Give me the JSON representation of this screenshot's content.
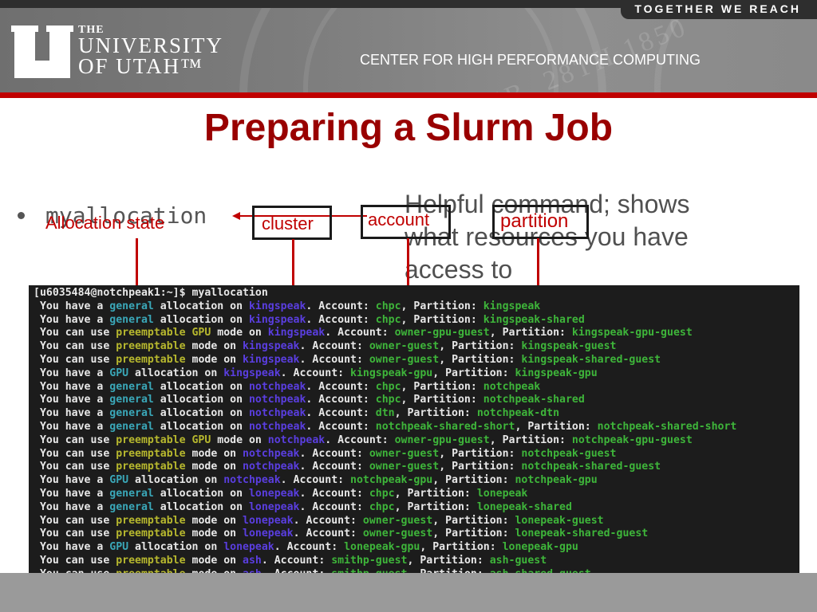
{
  "header": {
    "tagline": "TOGETHER WE REACH",
    "university_the": "THE",
    "university_line1": "UNIVERSITY",
    "university_line2": "OF UTAH™",
    "center_name": "CENTER FOR HIGH PERFORMANCE COMPUTING",
    "seal_text": "FEB. 28TH 1850",
    "colors": {
      "accent_red": "#c00000",
      "title_red": "#990000"
    }
  },
  "slide": {
    "title": "Preparing a Slurm Job",
    "bullet_command": "myallocation",
    "helpful_text": "Helpful command; shows what resources you have access to"
  },
  "annotations": {
    "allocation_state": "Allocation state",
    "cluster": "cluster",
    "account": "account",
    "partition": "partition"
  },
  "terminal": {
    "prompt": "[u6035484@notchpeak1:~]$ myallocation",
    "lines": [
      {
        "lead": " You have a ",
        "type": "general",
        "type_color": "cyan",
        "mid": " allocation on ",
        "cluster": "kingspeak",
        "account": "chpc",
        "partition": "kingspeak"
      },
      {
        "lead": " You have a ",
        "type": "general",
        "type_color": "cyan",
        "mid": " allocation on ",
        "cluster": "kingspeak",
        "account": "chpc",
        "partition": "kingspeak-shared"
      },
      {
        "lead": " You can use ",
        "type": "preemptable GPU",
        "type_color": "yellow",
        "mid": " mode on ",
        "cluster": "kingspeak",
        "account": "owner-gpu-guest",
        "partition": "kingspeak-gpu-guest"
      },
      {
        "lead": " You can use ",
        "type": "preemptable",
        "type_color": "yellow",
        "mid": " mode on ",
        "cluster": "kingspeak",
        "account": "owner-guest",
        "partition": "kingspeak-guest"
      },
      {
        "lead": " You can use ",
        "type": "preemptable",
        "type_color": "yellow",
        "mid": " mode on ",
        "cluster": "kingspeak",
        "account": "owner-guest",
        "partition": "kingspeak-shared-guest"
      },
      {
        "lead": " You have a ",
        "type": "GPU",
        "type_color": "cyan",
        "mid": " allocation on ",
        "cluster": "kingspeak",
        "account": "kingspeak-gpu",
        "partition": "kingspeak-gpu"
      },
      {
        "lead": " You have a ",
        "type": "general",
        "type_color": "cyan",
        "mid": " allocation on ",
        "cluster": "notchpeak",
        "account": "chpc",
        "partition": "notchpeak"
      },
      {
        "lead": " You have a ",
        "type": "general",
        "type_color": "cyan",
        "mid": " allocation on ",
        "cluster": "notchpeak",
        "account": "chpc",
        "partition": "notchpeak-shared"
      },
      {
        "lead": " You have a ",
        "type": "general",
        "type_color": "cyan",
        "mid": " allocation on ",
        "cluster": "notchpeak",
        "account": "dtn",
        "partition": "notchpeak-dtn"
      },
      {
        "lead": " You have a ",
        "type": "general",
        "type_color": "cyan",
        "mid": " allocation on ",
        "cluster": "notchpeak",
        "account": "notchpeak-shared-short",
        "partition": "notchpeak-shared-short"
      },
      {
        "lead": " You can use ",
        "type": "preemptable GPU",
        "type_color": "yellow",
        "mid": " mode on ",
        "cluster": "notchpeak",
        "account": "owner-gpu-guest",
        "partition": "notchpeak-gpu-guest"
      },
      {
        "lead": " You can use ",
        "type": "preemptable",
        "type_color": "yellow",
        "mid": " mode on ",
        "cluster": "notchpeak",
        "account": "owner-guest",
        "partition": "notchpeak-guest"
      },
      {
        "lead": " You can use ",
        "type": "preemptable",
        "type_color": "yellow",
        "mid": " mode on ",
        "cluster": "notchpeak",
        "account": "owner-guest",
        "partition": "notchpeak-shared-guest"
      },
      {
        "lead": " You have a ",
        "type": "GPU",
        "type_color": "cyan",
        "mid": " allocation on ",
        "cluster": "notchpeak",
        "account": "notchpeak-gpu",
        "partition": "notchpeak-gpu"
      },
      {
        "lead": " You have a ",
        "type": "general",
        "type_color": "cyan",
        "mid": " allocation on ",
        "cluster": "lonepeak",
        "account": "chpc",
        "partition": "lonepeak"
      },
      {
        "lead": " You have a ",
        "type": "general",
        "type_color": "cyan",
        "mid": " allocation on ",
        "cluster": "lonepeak",
        "account": "chpc",
        "partition": "lonepeak-shared"
      },
      {
        "lead": " You can use ",
        "type": "preemptable",
        "type_color": "yellow",
        "mid": " mode on ",
        "cluster": "lonepeak",
        "account": "owner-guest",
        "partition": "lonepeak-guest"
      },
      {
        "lead": " You can use ",
        "type": "preemptable",
        "type_color": "yellow",
        "mid": " mode on ",
        "cluster": "lonepeak",
        "account": "owner-guest",
        "partition": "lonepeak-shared-guest"
      },
      {
        "lead": " You have a ",
        "type": "GPU",
        "type_color": "cyan",
        "mid": " allocation on ",
        "cluster": "lonepeak",
        "account": "lonepeak-gpu",
        "partition": "lonepeak-gpu"
      },
      {
        "lead": " You can use ",
        "type": "preemptable",
        "type_color": "yellow",
        "mid": " mode on ",
        "cluster": "ash",
        "account": "smithp-guest",
        "partition": "ash-guest"
      },
      {
        "lead": " You can use ",
        "type": "preemptable",
        "type_color": "yellow",
        "mid": " mode on ",
        "cluster": "ash",
        "account": "smithp-guest",
        "partition": "ash-shared-guest"
      }
    ],
    "account_label": ". Account: ",
    "partition_label": ", Partition: "
  }
}
